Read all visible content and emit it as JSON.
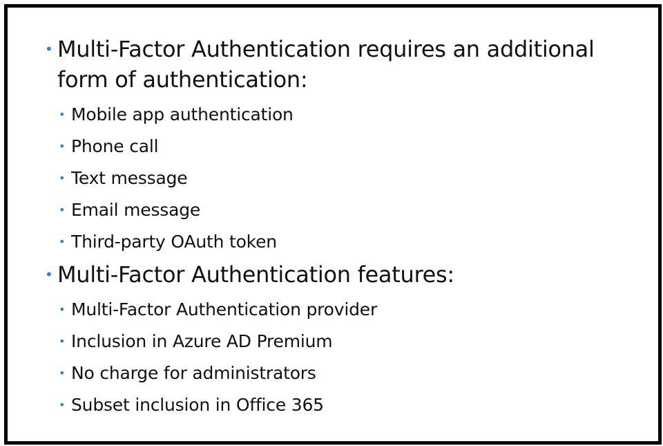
{
  "slide": {
    "sections": [
      {
        "heading": "Multi-Factor Authentication requires an additional form of authentication:",
        "items": [
          "Mobile app authentication",
          "Phone call",
          "Text message",
          "Email message",
          "Third-party OAuth token"
        ]
      },
      {
        "heading": "Multi-Factor Authentication features:",
        "items": [
          "Multi-Factor Authentication provider",
          "Inclusion in Azure AD Premium",
          "No charge for administrators",
          "Subset inclusion in Office 365"
        ]
      }
    ],
    "bullet_char": "•",
    "colors": {
      "bullet": "#2e7ed0",
      "border": "#000000",
      "text": "#111111"
    }
  }
}
